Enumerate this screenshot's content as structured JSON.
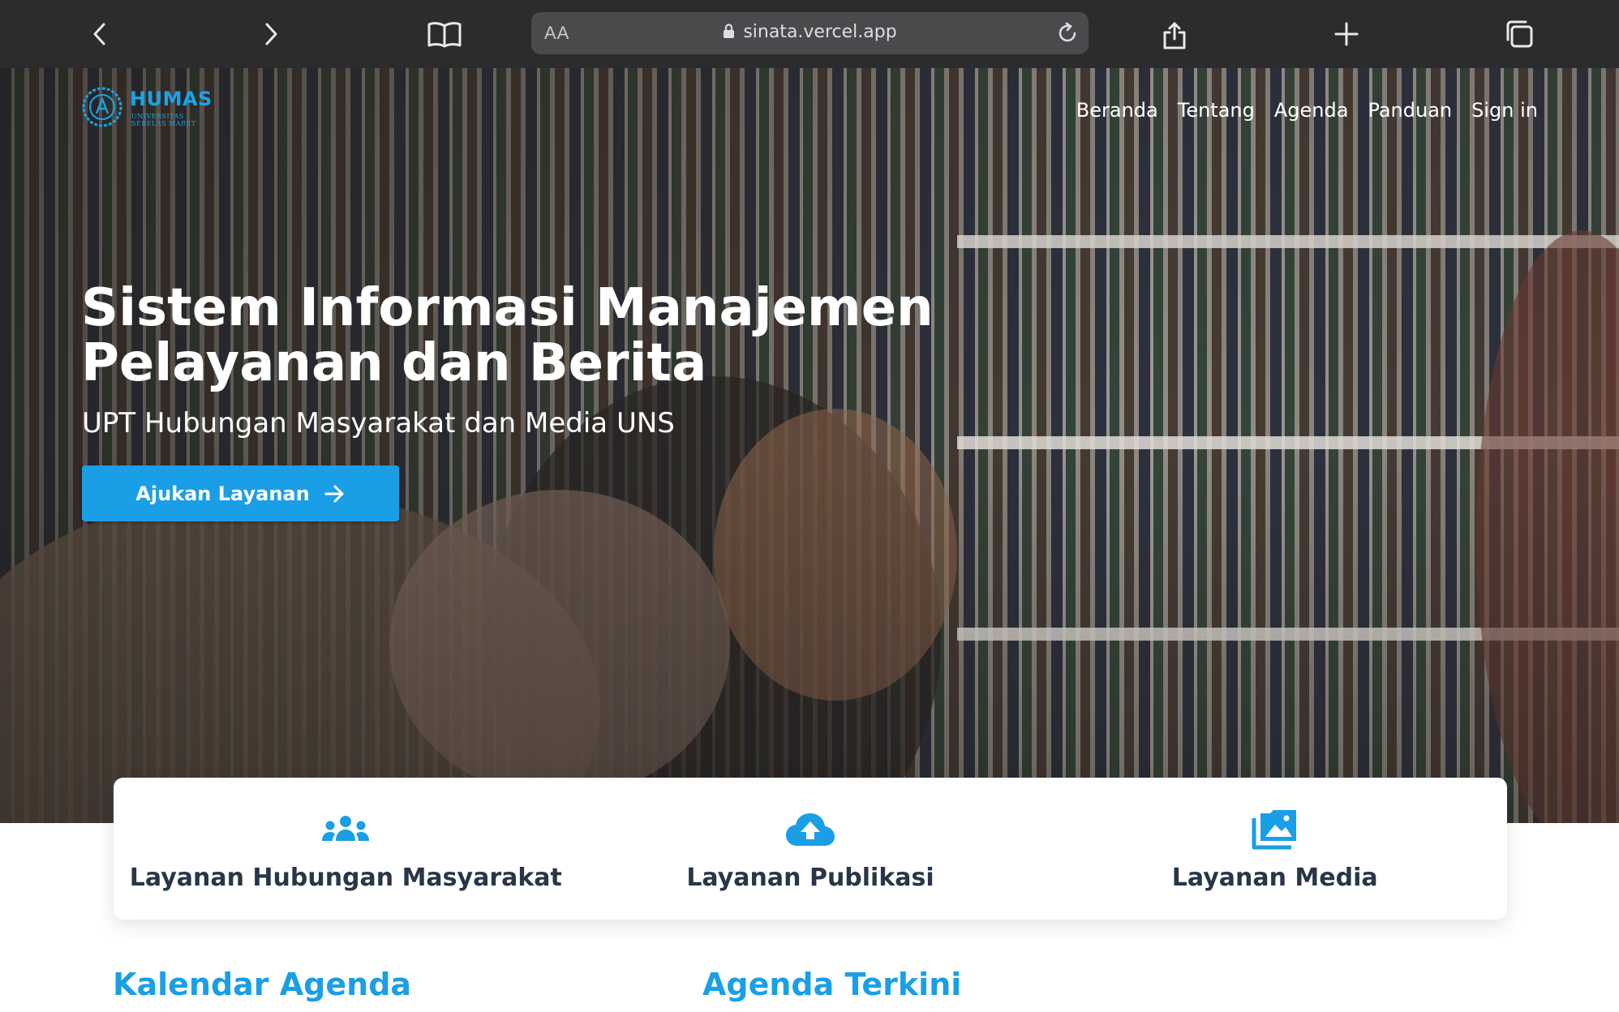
{
  "browser": {
    "url_text": "sinata.vercel.app",
    "reader_label": "AA",
    "icons": [
      "back-icon",
      "forward-icon",
      "bookmarks-icon",
      "lock-icon",
      "reload-icon",
      "share-icon",
      "new-tab-icon",
      "tabs-icon"
    ]
  },
  "header": {
    "logo_text": "HUMAS",
    "logo_sub_1": "UNIVERSITAS",
    "logo_sub_2": "SEBELAS MARET",
    "nav": [
      "Beranda",
      "Tentang",
      "Agenda",
      "Panduan",
      "Sign in"
    ]
  },
  "hero": {
    "title": "Sistem Informasi Manajemen Pelayanan dan Berita",
    "subtitle": "UPT Hubungan Masyarakat dan Media UNS",
    "cta_label": "Ajukan Layanan"
  },
  "services": [
    {
      "label": "Layanan Hubungan Masyarakat",
      "icon": "people-group-icon"
    },
    {
      "label": "Layanan Publikasi",
      "icon": "cloud-upload-icon"
    },
    {
      "label": "Layanan Media",
      "icon": "photo-album-icon"
    }
  ],
  "sections": {
    "calendar_title": "Kalendar Agenda",
    "latest_title": "Agenda Terkini"
  },
  "colors": {
    "accent": "#1a9fe6",
    "chrome_bg": "#2c2c2e",
    "heading_text": "#2a3548"
  }
}
